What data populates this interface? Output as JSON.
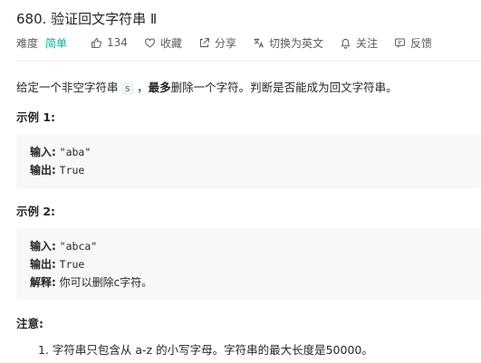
{
  "problem": {
    "title": "680. 验证回文字符串 Ⅱ"
  },
  "meta": {
    "difficulty_label": "难度",
    "difficulty_value": "简单",
    "likes": "134",
    "favorite": "收藏",
    "share": "分享",
    "switch_lang": "切换为英文",
    "follow": "关注",
    "feedback": "反馈"
  },
  "description": {
    "part1": "给定一个非空字符串",
    "code": "s",
    "part2": "，",
    "bold": "最多",
    "part3": "删除一个字符。判断是否能成为回文字符串。"
  },
  "example1": {
    "heading": "示例 1:",
    "input_label": "输入:",
    "input_value": "\"aba\"",
    "output_label": "输出:",
    "output_value": "True"
  },
  "example2": {
    "heading": "示例 2:",
    "input_label": "输入:",
    "input_value": "\"abca\"",
    "output_label": "输出:",
    "output_value": "True",
    "explain_label": "解释:",
    "explain_value": "你可以删除c字符。"
  },
  "note": {
    "heading": "注意:",
    "items": [
      "1. 字符串只包含从 a-z 的小写字母。字符串的最大长度是50000。"
    ]
  },
  "colors": {
    "accent": "#00af9b",
    "text": "#262626",
    "muted": "#5a5a5a",
    "code_bg": "#f7f8fa"
  },
  "icons": [
    "thumbs-up-icon",
    "heart-icon",
    "share-icon",
    "translate-icon",
    "bell-icon",
    "feedback-icon"
  ]
}
